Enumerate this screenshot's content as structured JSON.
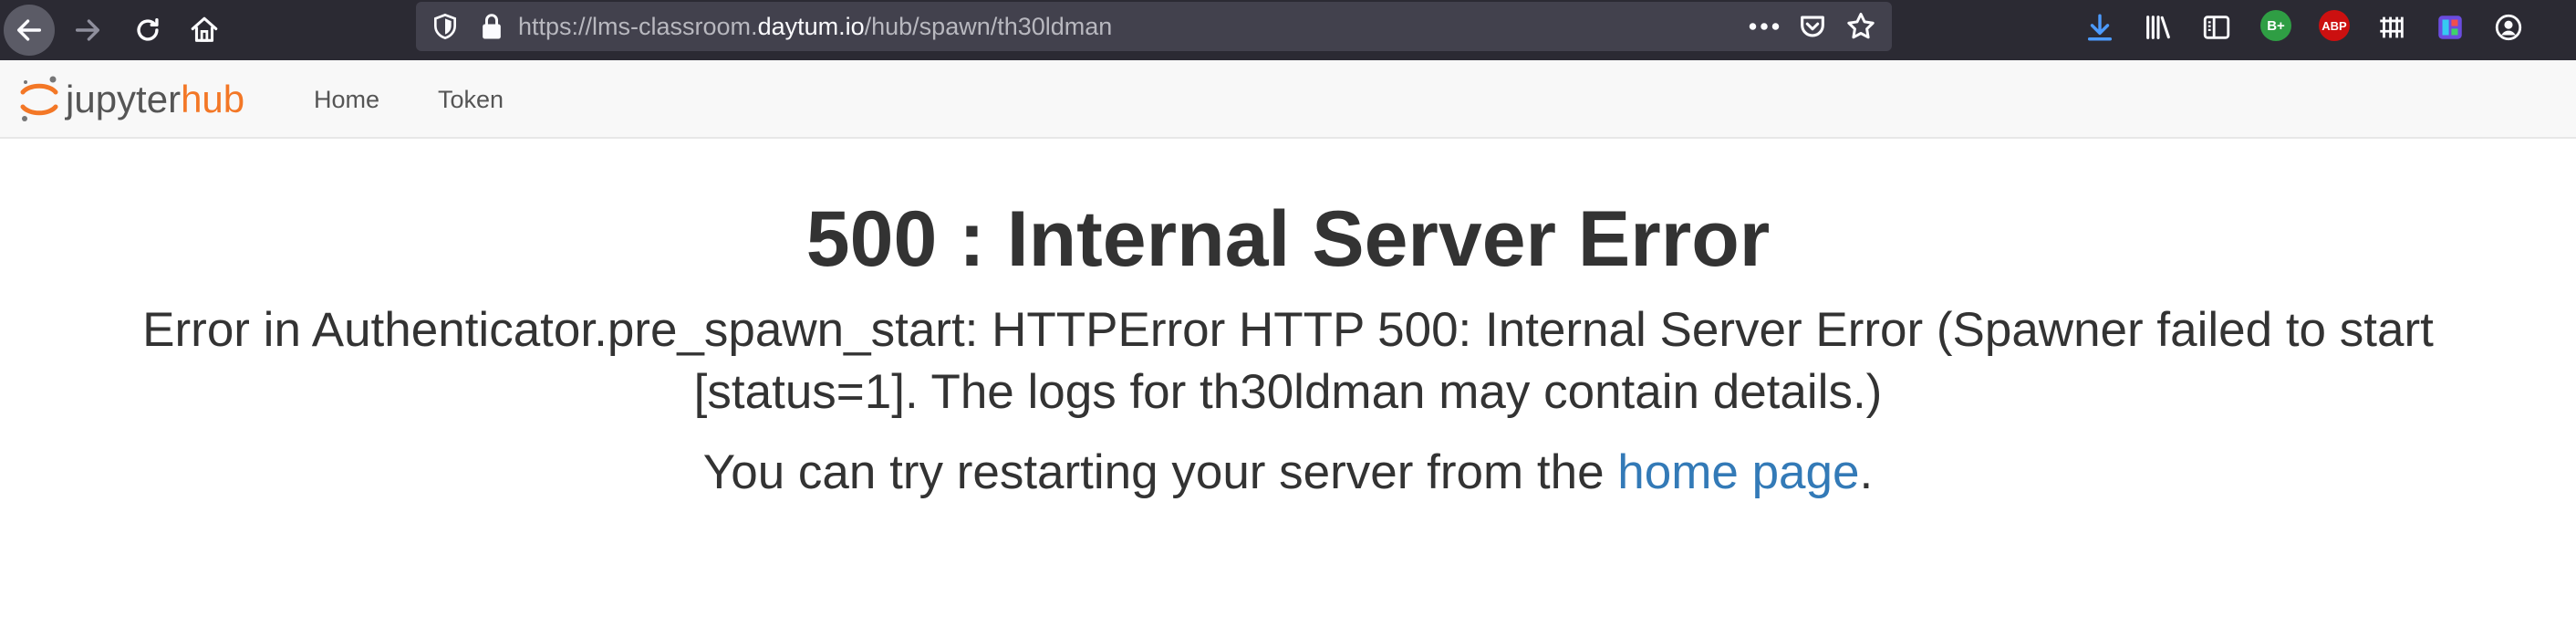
{
  "browser": {
    "url_prefix": "https://lms-classroom.",
    "url_host": "daytum.io",
    "url_path": "/hub/spawn/th30ldman",
    "extensions": {
      "bplus_label": "B+",
      "abp_label": "ABP"
    },
    "colors": {
      "toolbar_bg": "#2b2a33",
      "urlbar_bg": "#42414d",
      "download_accent": "#4c9bff",
      "bplus_bg": "#2f9e44",
      "abp_bg": "#cc1010"
    }
  },
  "header": {
    "logo_text_main": "jupyter",
    "logo_text_accent": "hub",
    "nav": {
      "home": "Home",
      "token": "Token"
    },
    "colors": {
      "brand_orange": "#f37726"
    }
  },
  "error": {
    "title": "500 : Internal Server Error",
    "message": "Error in Authenticator.pre_spawn_start: HTTPError HTTP 500: Internal Server Error (Spawner failed to start [status=1]. The logs for th30ldman may contain details.)",
    "hint_prefix": "You can try restarting your server from the ",
    "hint_link": "home page",
    "hint_suffix": ".",
    "colors": {
      "link": "#337ab7",
      "text": "#333333"
    }
  }
}
